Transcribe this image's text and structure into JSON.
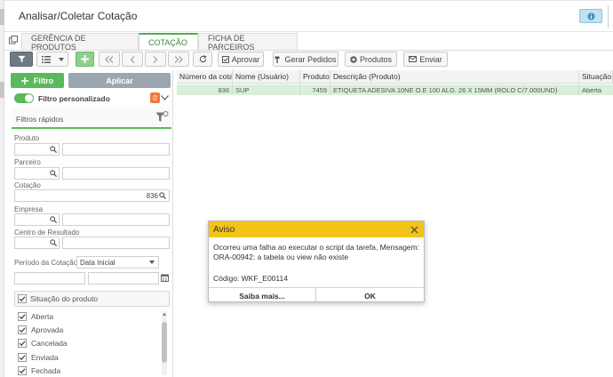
{
  "app": {
    "title": "Analisar/Coletar Cotação"
  },
  "tabs": [
    {
      "label": "GERÊNCIA DE PRODUTOS",
      "active": false
    },
    {
      "label": "COTAÇÃO",
      "active": true
    },
    {
      "label": "FICHA DE PARCEIROS",
      "active": false
    }
  ],
  "toolbar": {
    "filter_icon": "funnel-icon",
    "list_icon": "list-icon",
    "add_icon": "plus-icon",
    "refresh_icon": "refresh-icon",
    "approve_label": "Aprovar",
    "generate_orders_label": "Gerar Pedidos",
    "products_label": "Produtos",
    "send_label": "Enviar"
  },
  "filters_panel": {
    "filter_button_label": "Filtro",
    "apply_button_label": "Aplicar",
    "custom_filter_label": "Filtro personalizado",
    "custom_filter_count": "0",
    "quick_filters_title": "Filtros rápidos",
    "fields": {
      "product_label": "Produto",
      "partner_label": "Parceiro",
      "quotation_label": "Cotação",
      "quotation_value": "836",
      "company_label": "Empresa",
      "result_center_label": "Centro de Resultado",
      "period_label": "Período da Cotação",
      "period_select_value": "Data Inicial"
    },
    "product_status": {
      "title": "Situação do produto",
      "items": [
        "Aberta",
        "Aprovada",
        "Cancelada",
        "Enviada",
        "Fechada"
      ]
    }
  },
  "grid": {
    "columns": [
      "Número da cotação",
      "Nome (Usuário)",
      "Produto",
      "Descrição (Produto)",
      "Situação"
    ],
    "rows": [
      {
        "numero": "836",
        "usuario": "SUP",
        "produto": "7459",
        "descricao": "ETIQUETA ADESIVA 10NE O.E 100 ALG. 26 X 15MM (ROLO C/7.000UND)",
        "situacao": "Aberta"
      }
    ]
  },
  "dialog": {
    "title": "Aviso",
    "message": "Ocorreu uma falha ao executar o script da tarefa, Mensagem: ORA-00942: a tabela ou view não existe",
    "code": "Código: WKF_E00114",
    "learn_more_label": "Saiba mais...",
    "ok_label": "OK"
  },
  "colors": {
    "accent_green": "#5cb85c",
    "dialog_header": "#f3c318",
    "badge_orange": "#f07a3c",
    "selected_row": "#d9efd9"
  }
}
